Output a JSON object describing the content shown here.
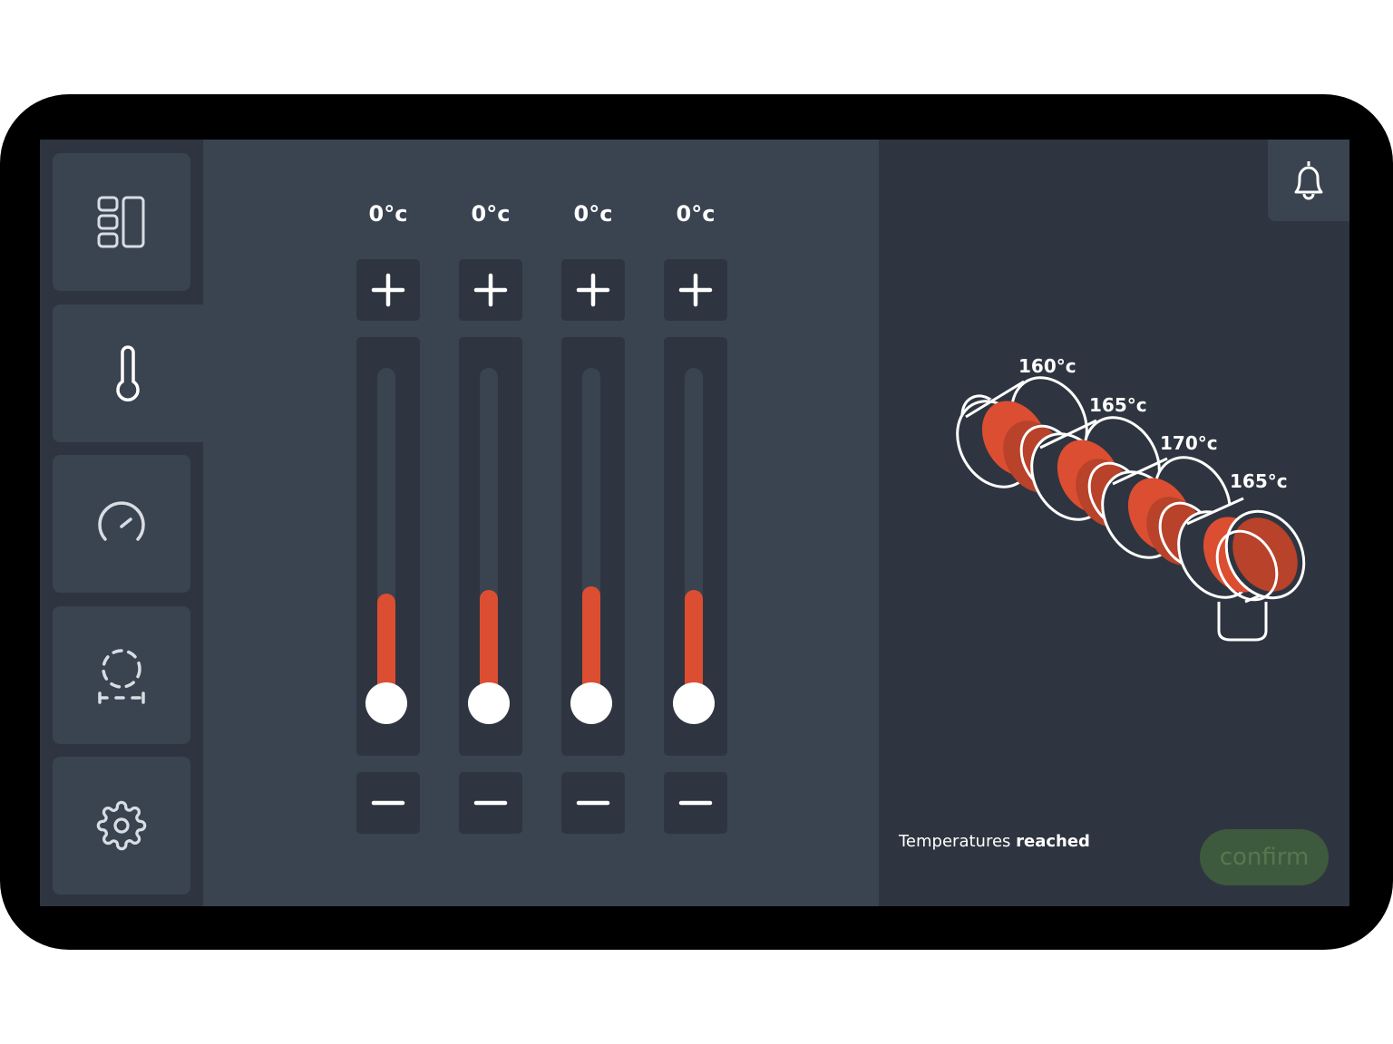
{
  "sidebar": {
    "items": [
      {
        "icon": "layout-icon"
      },
      {
        "icon": "thermometer-icon",
        "active": true
      },
      {
        "icon": "speedometer-icon"
      },
      {
        "icon": "mold-frame-icon"
      },
      {
        "icon": "gear-icon"
      }
    ]
  },
  "zones": [
    {
      "setpoint": "0°c",
      "level_percent": 31
    },
    {
      "setpoint": "0°c",
      "level_percent": 32
    },
    {
      "setpoint": "0°c",
      "level_percent": 33
    },
    {
      "setpoint": "0°c",
      "level_percent": 32
    }
  ],
  "diagram": {
    "zone_labels": [
      "160°c",
      "165°c",
      "170°c",
      "165°c"
    ]
  },
  "status": {
    "prefix": "Temperatures ",
    "emphasis": "reached"
  },
  "confirm_label": "confirm",
  "colors": {
    "accent": "#dc4e31",
    "panel": "#3a4350",
    "panel_dark": "#2e3540",
    "confirm_bg": "#3e5a3e"
  }
}
